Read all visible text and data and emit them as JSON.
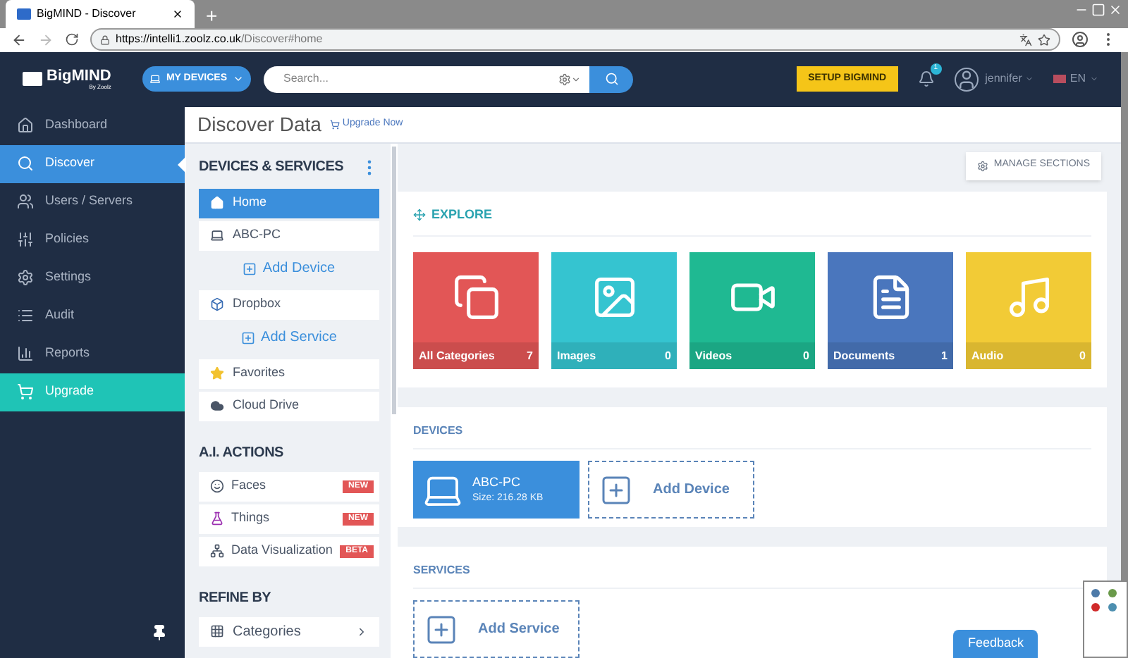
{
  "browser": {
    "tab_title": "BigMIND - Discover",
    "new_tab": "+",
    "url_host": "https://intelli1.zoolz.co.uk",
    "url_path": "/Discover#home"
  },
  "header": {
    "logo_text": "BigMIND",
    "logo_sub": "By Zoolz",
    "devices_button": "MY DEVICES",
    "search": {
      "placeholder": "Search..."
    },
    "setup_button": "SETUP BIGMIND",
    "notifications": "1",
    "user": "jennifer",
    "language": "EN"
  },
  "sidebar": {
    "items": [
      {
        "label": "Dashboard",
        "kind": "normal",
        "selected": false
      },
      {
        "label": "Discover",
        "kind": "normal",
        "selected": true
      },
      {
        "label": "Users / Servers",
        "kind": "normal",
        "selected": false
      },
      {
        "label": "Policies",
        "kind": "normal",
        "selected": false
      },
      {
        "label": "Settings",
        "kind": "normal",
        "selected": false
      },
      {
        "label": "Audit",
        "kind": "normal",
        "selected": false
      },
      {
        "label": "Reports",
        "kind": "normal",
        "selected": false
      },
      {
        "label": "Upgrade",
        "kind": "upgrade",
        "selected": false
      }
    ]
  },
  "page": {
    "title": "Discover Data",
    "upgrade_link": "Upgrade Now"
  },
  "left_panel": {
    "devices_services": {
      "title": "DEVICES & SERVICES",
      "items": [
        {
          "label": "Home",
          "kind": "item",
          "selected": true
        },
        {
          "label": "ABC-PC",
          "kind": "item",
          "selected": false
        },
        {
          "label": "Add Device",
          "kind": "add"
        },
        {
          "label": "Dropbox",
          "kind": "item",
          "selected": false
        },
        {
          "label": "Add Service",
          "kind": "add"
        },
        {
          "label": "Favorites",
          "kind": "item",
          "selected": false
        },
        {
          "label": "Cloud Drive",
          "kind": "item",
          "selected": false
        }
      ]
    },
    "ai_actions": {
      "title": "A.I. ACTIONS",
      "items": [
        {
          "label": "Faces",
          "badge": "NEW"
        },
        {
          "label": "Things",
          "badge": "NEW"
        },
        {
          "label": "Data Visualization",
          "badge": "BETA"
        }
      ]
    },
    "refine_by": {
      "title": "REFINE BY",
      "items": [
        {
          "label": "Categories"
        }
      ]
    }
  },
  "main": {
    "manage_button": "MANAGE SECTIONS",
    "explore": {
      "title": "EXPLORE",
      "tiles": [
        {
          "label": "All Categories",
          "count": "7",
          "color": "#e25656"
        },
        {
          "label": "Images",
          "count": "0",
          "color": "#35c4d0"
        },
        {
          "label": "Videos",
          "count": "0",
          "color": "#1fb992"
        },
        {
          "label": "Documents",
          "count": "1",
          "color": "#4a76bd"
        },
        {
          "label": "Audio",
          "count": "0",
          "color": "#f2cb36"
        }
      ]
    },
    "devices": {
      "title": "DEVICES",
      "device": {
        "name": "ABC-PC",
        "size": "Size: 216.28 KB"
      },
      "add": "Add Device"
    },
    "services": {
      "title": "SERVICES",
      "add": "Add Service"
    }
  },
  "feedback_button": "Feedback"
}
